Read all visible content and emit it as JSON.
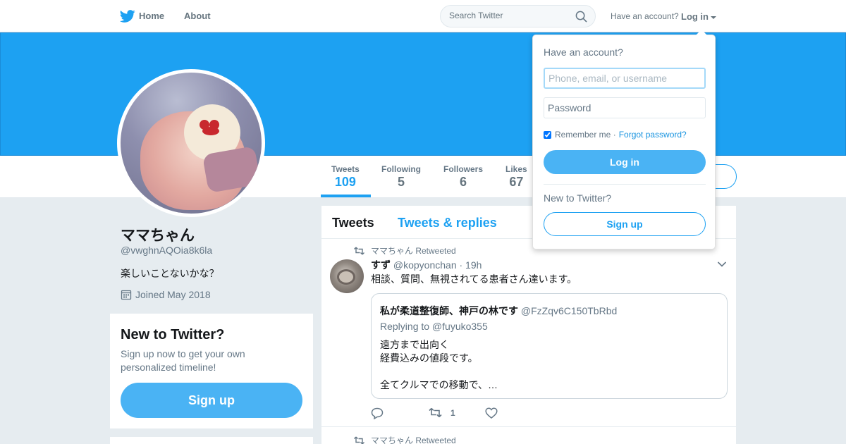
{
  "topbar": {
    "home_label": "Home",
    "about_label": "About",
    "search_placeholder": "Search Twitter",
    "have_account": "Have an account?",
    "login_label": "Log in"
  },
  "profile": {
    "name": "ママちゃん",
    "handle": "@vwghnAQOia8k6la",
    "bio": "楽しいことないかな？",
    "joined": "Joined May 2018"
  },
  "stats": [
    {
      "label": "Tweets",
      "value": "109"
    },
    {
      "label": "Following",
      "value": "5"
    },
    {
      "label": "Followers",
      "value": "6"
    },
    {
      "label": "Likes",
      "value": "67"
    }
  ],
  "new_card": {
    "title": "New to Twitter?",
    "text": "Sign up now to get your own personalized timeline!",
    "button": "Sign up"
  },
  "timeline": {
    "tabs": [
      "Tweets",
      "Tweets & replies"
    ],
    "tweets": [
      {
        "retweeted_by": "ママちゃん Retweeted",
        "author_name": "すず",
        "author_handle": "@kopyonchan",
        "time": "· 19h",
        "text": "相談、質問、無視されてる患者さん達います。",
        "quote": {
          "author_name": "私が柔道整復師、神戸の林です",
          "author_handle": "@FzZqv6C150TbRbd",
          "replying": "Replying to @fuyuko355",
          "lines": [
            "遠方まで出向く",
            "経費込みの値段です。",
            "",
            "全てクルマでの移動で、…"
          ]
        },
        "retweet_count": "1"
      },
      {
        "retweeted_by": "ママちゃん Retweeted"
      }
    ]
  },
  "login_dropdown": {
    "title": "Have an account?",
    "username_placeholder": "Phone, email, or username",
    "password_placeholder": "Password",
    "remember": "Remember me ·",
    "forgot": "Forgot password?",
    "login_button": "Log in",
    "new_text": "New to Twitter?",
    "signup_button": "Sign up"
  },
  "colors": {
    "brand": "#1da1f2",
    "button": "#4ab3f4",
    "background": "#e6ecf0"
  }
}
